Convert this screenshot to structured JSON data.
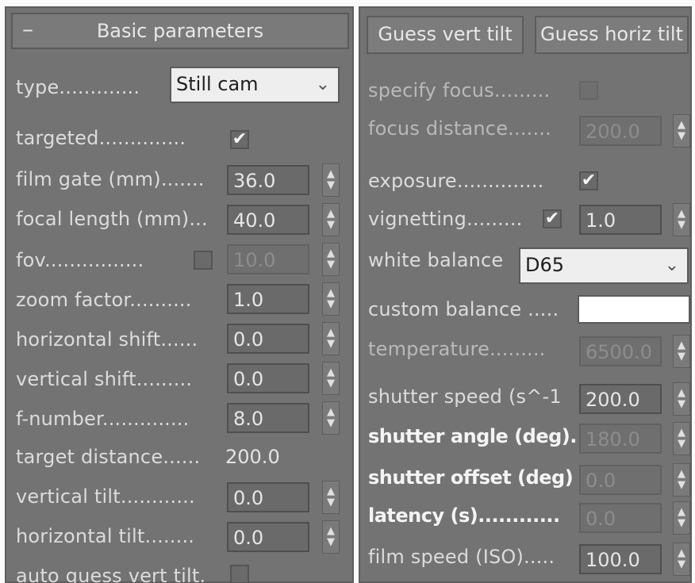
{
  "left": {
    "rollout_toggle": "–",
    "rollout_title": "Basic parameters",
    "type_label": "type.............",
    "type_value": "Still cam",
    "targeted_label": "targeted..............",
    "film_gate_label": "film gate (mm).......",
    "film_gate_value": "36.0",
    "focal_length_label": "focal length (mm)...",
    "focal_length_value": "40.0",
    "fov_label": "fov................",
    "fov_value": "10.0",
    "zoom_factor_label": "zoom factor..........",
    "zoom_factor_value": "1.0",
    "horizontal_shift_label": "horizontal shift......",
    "horizontal_shift_value": "0.0",
    "vertical_shift_label": "vertical shift.........",
    "vertical_shift_value": "0.0",
    "f_number_label": "f-number..............",
    "f_number_value": "8.0",
    "target_distance_label": "target distance......",
    "target_distance_value": "200.0",
    "vertical_tilt_label": "vertical tilt............",
    "vertical_tilt_value": "0.0",
    "horizontal_tilt_label": "horizontal tilt........",
    "horizontal_tilt_value": "0.0",
    "auto_guess_label": "auto guess vert tilt."
  },
  "right": {
    "guess_vert_tilt_label": "Guess vert tilt",
    "guess_horiz_tilt_label": "Guess horiz tilt",
    "specify_focus_label": "specify focus.........",
    "focus_distance_label": "focus distance.......",
    "focus_distance_value": "200.0",
    "exposure_label": "exposure..............",
    "vignetting_label": "vignetting.........",
    "vignetting_value": "1.0",
    "white_balance_label": "white balance",
    "white_balance_value": "D65",
    "custom_balance_label": "custom balance .....",
    "temperature_label": "temperature.........",
    "temperature_value": "6500.0",
    "shutter_speed_label": "shutter speed (s^-1",
    "shutter_speed_value": "200.0",
    "shutter_angle_label": "shutter angle (deg).",
    "shutter_angle_value": "180.0",
    "shutter_offset_label": "shutter offset (deg)",
    "shutter_offset_value": "0.0",
    "latency_label": "latency (s)............",
    "latency_value": "0.0",
    "film_speed_label": "film speed (ISO).....",
    "film_speed_value": "100.0"
  },
  "icons": {
    "check": "✔",
    "spinner": "spinner-arrows-icon",
    "dropdown": "chevron-down-icon"
  },
  "colors": {
    "panel_bg": "#737373",
    "field_bg": "#6a6a6a",
    "dropdown_bg": "#eeeeee",
    "swatch": "#ffffff"
  }
}
